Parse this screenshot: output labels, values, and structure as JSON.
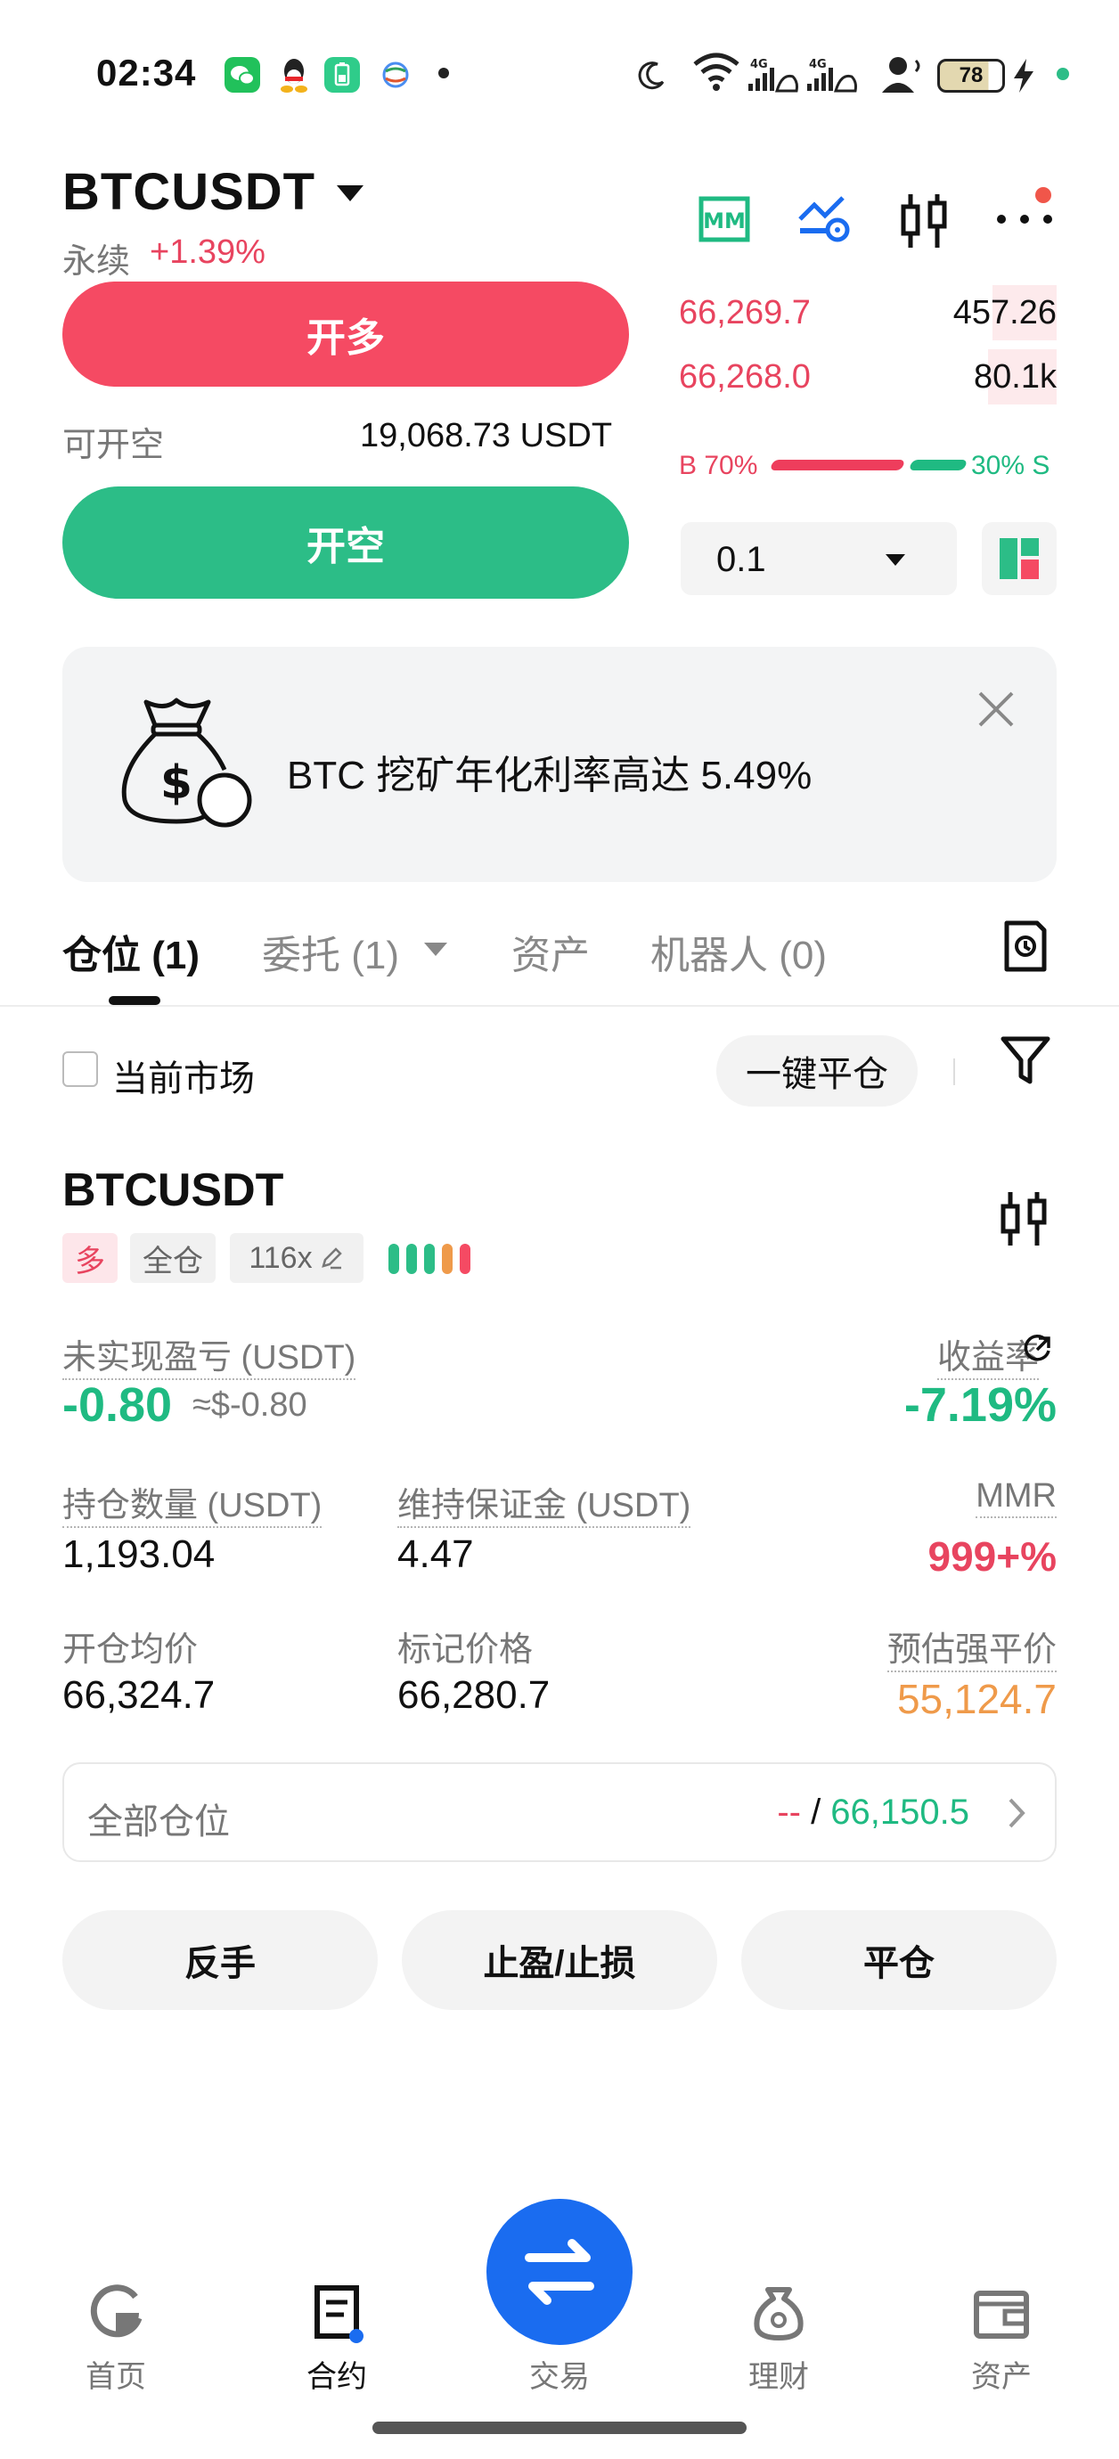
{
  "status_bar": {
    "time": "02:34",
    "battery": "78",
    "icons": [
      "wechat-icon",
      "qq-icon",
      "battery-app-icon",
      "network-app-icon",
      "dot-icon",
      "moon-icon",
      "wifi-icon",
      "signal-4g-icon",
      "signal-4g-icon",
      "user-sound-icon",
      "charging-icon"
    ]
  },
  "header": {
    "pair": "BTCUSDT",
    "contract_type": "永续",
    "change": "+1.39%",
    "icons": [
      "mm-icon",
      "chart-settings-icon",
      "candlestick-icon",
      "more-icon"
    ]
  },
  "order": {
    "long_label": "开多",
    "short_label": "开空",
    "available_label": "可开空",
    "available_value": "19,068.73 USDT",
    "quantity": "0.1"
  },
  "orderbook": {
    "asks": [
      {
        "price": "66,269.7",
        "qty": "457.26",
        "depth": 0.17
      },
      {
        "price": "66,268.0",
        "qty": "80.1k",
        "depth": 0.18
      }
    ],
    "buy_ratio": "B 70%",
    "sell_ratio": "30% S",
    "buy_fraction": 0.7
  },
  "banner": {
    "text": "BTC 挖矿年化利率高达 5.49%"
  },
  "tabs": [
    {
      "label": "仓位 (1)",
      "active": true
    },
    {
      "label": "委托 (1)",
      "active": false
    },
    {
      "label": "资产",
      "active": false
    },
    {
      "label": "机器人 (0)",
      "active": false
    }
  ],
  "filters": {
    "current_market": "当前市场",
    "close_all": "一键平仓"
  },
  "position": {
    "symbol": "BTCUSDT",
    "side": "多",
    "margin_mode": "全仓",
    "leverage": "116x",
    "unrealized_pnl_label": "未实现盈亏 (USDT)",
    "unrealized_pnl": "-0.80",
    "unrealized_pnl_usd": "≈$-0.80",
    "roe_label": "收益率",
    "roe": "-7.19%",
    "size_label": "持仓数量 (USDT)",
    "size": "1,193.04",
    "maint_margin_label": "维持保证金 (USDT)",
    "maint_margin": "4.47",
    "mmr_label": "MMR",
    "mmr": "999+%",
    "entry_label": "开仓均价",
    "entry": "66,324.7",
    "mark_label": "标记价格",
    "mark": "66,280.7",
    "liq_label": "预估强平价",
    "liq": "55,124.7",
    "all_positions_label": "全部仓位",
    "all_positions_value_a": "--",
    "all_positions_sep": " / ",
    "all_positions_value_b": "66,150.5",
    "reverse": "反手",
    "tpsl": "止盈/止损",
    "close": "平仓"
  },
  "colors": {
    "long": "#f54a63",
    "short": "#2cbd87",
    "brand": "#1a6cf0",
    "liq": "#ef9a4a"
  },
  "nav": [
    {
      "label": "首页",
      "icon": "home-icon"
    },
    {
      "label": "合约",
      "icon": "contract-icon",
      "active": true
    },
    {
      "label": "交易",
      "icon": "trade-swap-icon"
    },
    {
      "label": "理财",
      "icon": "earn-icon"
    },
    {
      "label": "资产",
      "icon": "wallet-icon"
    }
  ]
}
